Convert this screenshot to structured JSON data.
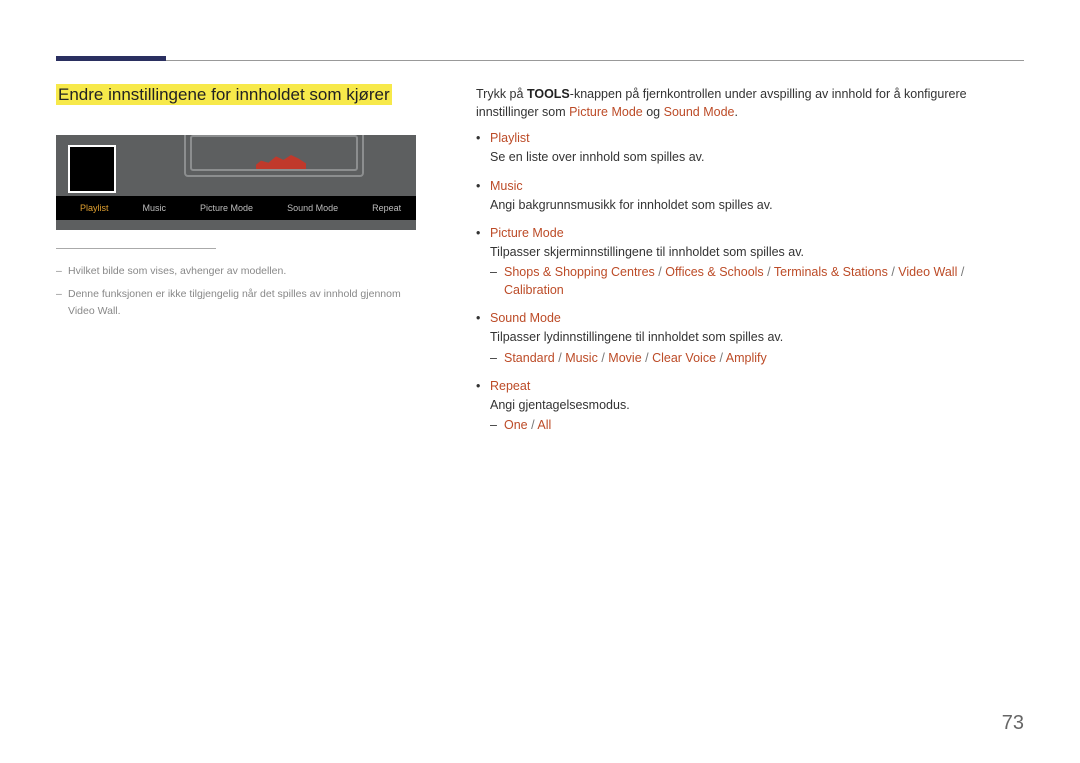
{
  "page_number": "73",
  "section_title": "Endre innstillingene for innholdet som kjører",
  "illustration_menu": [
    "Playlist",
    "Music",
    "Picture Mode",
    "Sound Mode",
    "Repeat"
  ],
  "notes": [
    "Hvilket bilde som vises, avhenger av modellen.",
    "Denne funksjonen er ikke tilgjengelig når det spilles av innhold gjennom Video Wall."
  ],
  "intro": {
    "prefix": "Trykk på ",
    "bold": "TOOLS",
    "mid": "-knappen på fjernkontrollen under avspilling av innhold for å konfigurere innstillinger som ",
    "link1": "Picture Mode",
    "og": " og ",
    "link2": "Sound Mode",
    "end": "."
  },
  "features": [
    {
      "title": "Playlist",
      "desc": "Se en liste over innhold som spilles av."
    },
    {
      "title": "Music",
      "desc": "Angi bakgrunnsmusikk for innholdet som spilles av."
    },
    {
      "title": "Picture Mode",
      "desc": "Tilpasser skjerminnstillingene til innholdet som spilles av.",
      "options": [
        "Shops & Shopping Centres",
        "Offices & Schools",
        "Terminals & Stations",
        "Video Wall",
        "Calibration"
      ]
    },
    {
      "title": "Sound Mode",
      "desc": "Tilpasser lydinnstillingene til innholdet som spilles av.",
      "options": [
        "Standard",
        "Music",
        "Movie",
        "Clear Voice",
        "Amplify"
      ]
    },
    {
      "title": "Repeat",
      "desc": "Angi gjentagelsesmodus.",
      "options": [
        "One",
        "All"
      ]
    }
  ]
}
